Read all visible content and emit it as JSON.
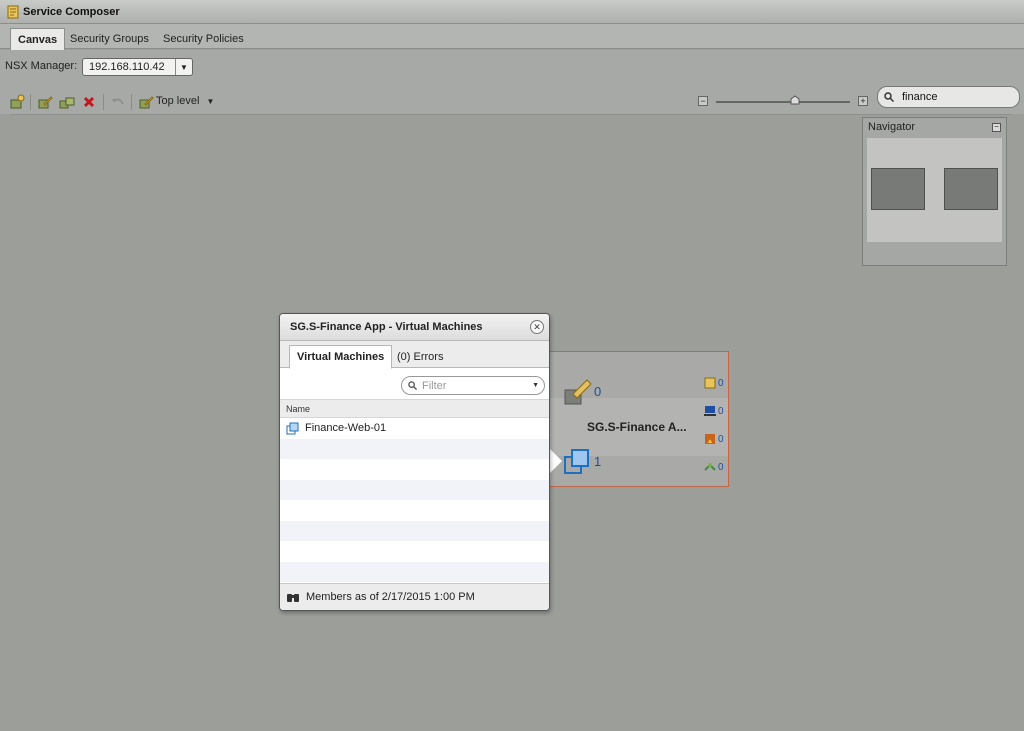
{
  "window": {
    "title": "Service Composer"
  },
  "tabs": [
    {
      "label": "Canvas",
      "active": true
    },
    {
      "label": "Security Groups",
      "active": false
    },
    {
      "label": "Security Policies",
      "active": false
    }
  ],
  "nsx": {
    "label": "NSX Manager:",
    "value": "192.168.110.42"
  },
  "toolbar": {
    "top_level_label": "Top level"
  },
  "search": {
    "value": "finance"
  },
  "navigator": {
    "title": "Navigator"
  },
  "security_group_node": {
    "name": "SG.S-Finance A...",
    "policy_count": "0",
    "vm_count": "1",
    "side_counts": [
      "0",
      "0",
      "0",
      "0"
    ]
  },
  "popup": {
    "title": "SG.S-Finance App - Virtual Machines",
    "tabs": [
      "Virtual Machines",
      "(0) Errors"
    ],
    "filter_placeholder": "Filter",
    "column_header": "Name",
    "rows": [
      "Finance-Web-01"
    ],
    "footer": "Members as of 2/17/2015 1:00 PM"
  },
  "colors": {
    "accent_blue": "#1f4fa3",
    "node_border": "#c0694a"
  }
}
